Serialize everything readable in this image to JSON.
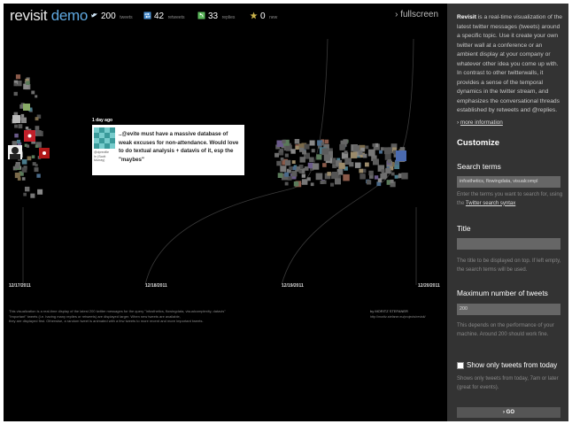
{
  "header": {
    "brand_name": "revisit",
    "brand_suffix": "demo",
    "stats": [
      {
        "icon": "bird-icon",
        "value": "200",
        "label": "tweets",
        "color": "#cfe6f7"
      },
      {
        "icon": "retweet-icon",
        "value": "42",
        "label": "retweets",
        "color": "#4a8fd0"
      },
      {
        "icon": "reply-icon",
        "value": "33",
        "label": "replies",
        "color": "#5cb85c"
      },
      {
        "icon": "star-icon",
        "value": "0",
        "label": "new",
        "color": "#c9b24a"
      }
    ],
    "fullscreen_label": "› fullscreen"
  },
  "timeline": {
    "dates": [
      "12/17/2011",
      "12/18/2011",
      "12/19/2011",
      "12/20/2011"
    ]
  },
  "tooltip": {
    "age": "1 day ago",
    "user": "@dpreville\nIn (Scott\nMurray)",
    "text": "..@evite must have a massive database of weak excuses for non-attendance. Would love to do textual analysis + datavis of it, esp the \"maybes\""
  },
  "footer": {
    "lines": [
      "This visualization is a real-time display of the latest 200 twitter messages for the query \"infosthetics, flowingdata, visualcomplexity, datavis\"",
      "\"Important\" tweets (i.e. having many replies or retweets) are displayed larger. When new tweets are available,",
      "they are displayed first. Otherwise, a random tweet is animated with a few tweets to more recent and more important tweets."
    ],
    "credit_by": "by MORITZ STEFANER",
    "credit_url": "http://moritz.stefaner.eu/projects/revisit/"
  },
  "sidebar": {
    "intro_name": "Revisit",
    "intro_body": " is a real-time visualization of the latest twitter messages (tweets) around a specific topic. Use it create your own twitter wall at a conference or an ambient display at your company or whatever other idea you come up with. In contrast to other twitterwalls, it provides a sense of the temporal dynamics in the twitter stream, and emphasizes the conversational threads established by retweets and @replies.",
    "more_info": "more information",
    "customize": "Customize",
    "search_label": "Search terms",
    "search_value": "infosthetics, flowingdata, visualcompl",
    "search_hint_prefix": "Enter the terms you want to search for, using the ",
    "search_hint_link": "Twitter search syntax",
    "title_label": "Title",
    "title_value": "",
    "title_hint": "The title to be displayed on top. If left empty, the search terms will be used.",
    "max_label": "Maximum number of tweets",
    "max_value": "200",
    "max_hint": "This depends on the performance of your machine. Around 200 should work fine.",
    "today_label": "Show only tweets from today",
    "today_hint": "Shows only tweets from today, 7am or later (great for events).",
    "go_label": "› GO"
  }
}
